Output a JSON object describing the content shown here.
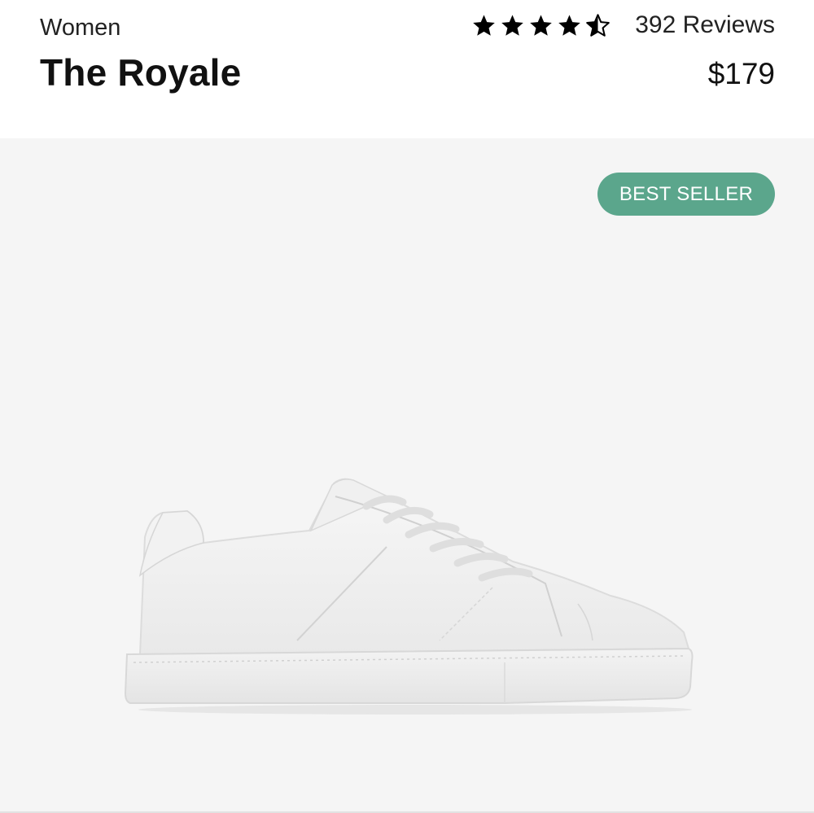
{
  "product": {
    "category": "Women",
    "name": "The Royale",
    "price": "$179",
    "rating": 4.5,
    "rating_max": 5,
    "reviews_label": "392 Reviews",
    "badge": "BEST SELLER"
  },
  "icons": {
    "star_full": "star-full-icon",
    "star_half": "star-half-icon"
  },
  "colors": {
    "badge_bg": "#5ba68c",
    "text": "#111111",
    "gallery_bg": "#f5f5f5"
  }
}
